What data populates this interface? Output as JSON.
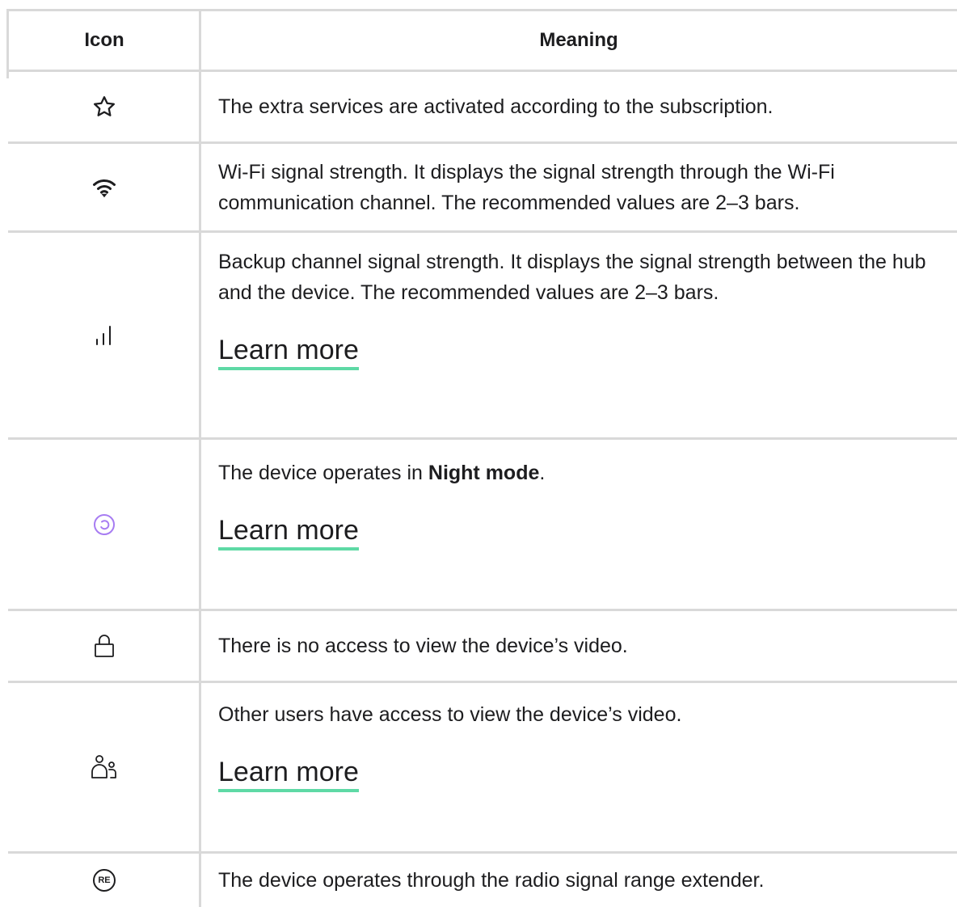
{
  "header": {
    "icon_label": "Icon",
    "meaning_label": "Meaning"
  },
  "rows": [
    {
      "icon": "star-icon",
      "text": "The extra services are activated according to the subscription."
    },
    {
      "icon": "wifi-icon",
      "text": "Wi-Fi signal strength. It displays the signal strength through the Wi-Fi communication channel. The recommended values are 2–3 bars."
    },
    {
      "icon": "signal-bars-icon",
      "text": "Backup channel signal strength. It displays the signal strength between the hub and the device. The recommended values are 2–3 bars.",
      "link": "Learn more"
    },
    {
      "icon": "night-mode-icon",
      "text_before": "The device operates in ",
      "text_bold": "Night mode",
      "text_after": ".",
      "link": "Learn more"
    },
    {
      "icon": "lock-icon",
      "text": "There is no access to view the device’s video."
    },
    {
      "icon": "users-icon",
      "text": "Other users have access to view the device’s video.",
      "link": "Learn more"
    },
    {
      "icon": "re-icon",
      "icon_text": "RE",
      "text": "The device operates through the radio signal range extender."
    }
  ],
  "colors": {
    "border": "#d9d9d9",
    "link_underline": "#5ed9a5",
    "night_mode_icon": "#a77cf2",
    "text": "#1d1d1f"
  }
}
